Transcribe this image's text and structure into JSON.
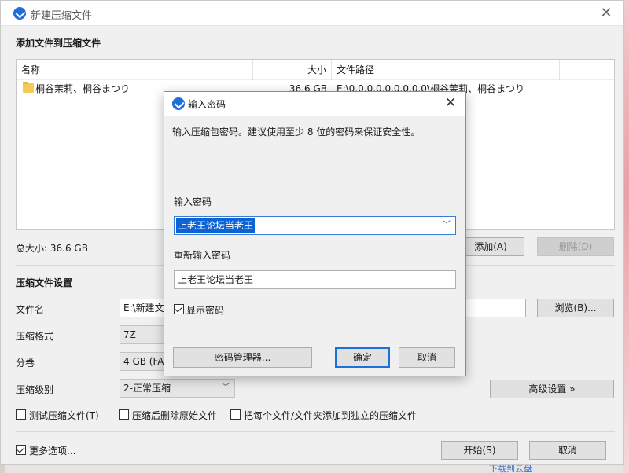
{
  "window": {
    "title": "新建压缩文件"
  },
  "add_files": {
    "heading": "添加文件到压缩文件",
    "columns": {
      "name": "名称",
      "size": "大小",
      "path": "文件路径"
    },
    "rows": [
      {
        "name": "桐谷茉莉、桐谷まつり",
        "size": "36.6 GB",
        "path": "E:\\0.0.0.0.0.0.0.0.0\\桐谷茉莉、桐谷まつり"
      }
    ],
    "total_size": "总大小: 36.6 GB",
    "add_button": "添加(A)",
    "delete_button": "删除(D)"
  },
  "settings": {
    "heading": "压缩文件设置",
    "filename_label": "文件名",
    "filename_value": "E:\\新建文",
    "browse_button": "浏览(B)...",
    "format_label": "压缩格式",
    "format_value": "7Z",
    "split_label": "分卷",
    "split_value": "4 GB (FAT",
    "level_label": "压缩级别",
    "level_value": "2-正常压缩",
    "advanced_button": "高级设置 »",
    "test_check": "测试压缩文件(T)",
    "delete_after_check": "压缩后删除原始文件",
    "separate_check": "把每个文件/文件夹添加到独立的压缩文件",
    "more_options": "更多选项...",
    "start_button": "开始(S)",
    "cancel_button": "取消"
  },
  "dialog": {
    "title": "输入密码",
    "description": "输入压缩包密码。建议使用至少 8 位的密码来保证安全性。",
    "password_label": "输入密码",
    "password_value": "上老王论坛当老王",
    "confirm_label": "重新输入密码",
    "confirm_value": "上老王论坛当老王",
    "show_password": "显示密码",
    "manager_button": "密码管理器...",
    "ok_button": "确定",
    "cancel_button": "取消"
  },
  "background": {
    "link_fragment": "下载到云盘"
  },
  "colors": {
    "accent": "#1e6fd9",
    "selection": "#0a64d6"
  }
}
